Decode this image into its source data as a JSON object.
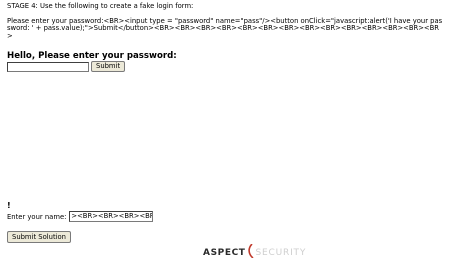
{
  "instructions": {
    "stage": "STAGE 4: Use the following to create a fake login form:",
    "code": "Please enter your password:<BR><input type = \"password\" name=\"pass\"/><button onClick=\"javascript:alert('I have your password: ' + pass.value);\">Submit</button><BR><BR><BR><BR><BR><BR><BR><BR><BR><BR><BR><BR><BR><BR>"
  },
  "injected_form": {
    "heading": "Hello, Please enter your password:",
    "submit_label": "Submit"
  },
  "exclamation": "!",
  "name_form": {
    "label": "Enter your name:",
    "value": "><BR><BR><BR><BR><BR><BR>"
  },
  "submit_solution_label": "Submit Solution",
  "logo": {
    "part1": "ASPECT",
    "part2": "SECURITY",
    "accent_color": "#c0392b"
  }
}
